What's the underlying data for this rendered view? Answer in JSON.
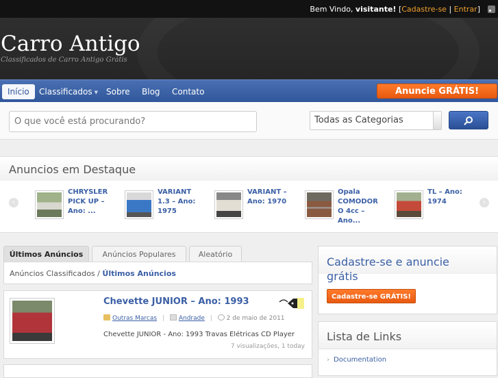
{
  "topbar": {
    "welcome_prefix": "Bem Vindo,",
    "welcome_user": "visitante!",
    "open_bracket": "[",
    "register": "Cadastre-se",
    "divider": "|",
    "login": "Entrar",
    "close_bracket": "]"
  },
  "header": {
    "logo": "Carro Antigo",
    "tagline": "Classificados de Carro Antigo Grátis"
  },
  "nav": {
    "items": [
      "Início",
      "Classificados",
      "Sobre",
      "Blog",
      "Contato"
    ],
    "cta": "Anuncie GRÁTIS!"
  },
  "search": {
    "placeholder": "O que você está procurando?",
    "category": "Todas as Categorias"
  },
  "featured": {
    "title": "Anuncios em Destaque",
    "items": [
      {
        "label": "CHRYSLER PICK UP – Ano: ...",
        "color": "#b9c3b0"
      },
      {
        "label": "VARIANT 1.3 – Ano: 1975",
        "color": "#3a78c5"
      },
      {
        "label": "VARIANT – Ano: 1970",
        "color": "#c9c4b8"
      },
      {
        "label": "Opala COMODOR O 4cc – Ano...",
        "color": "#8a5a40"
      },
      {
        "label": "TL – Ano: 1974",
        "color": "#c44a3a"
      }
    ]
  },
  "tabs": [
    "Últimos Anúncios",
    "Anúncios Populares",
    "Aleatório"
  ],
  "breadcrumb": {
    "root": "Anúncios Classificados",
    "separator": "/",
    "current": "Últimos Anúncios"
  },
  "listing": {
    "title": "Chevette JUNIOR – Ano: 1993",
    "category": "Outras Marcas",
    "author": "Andrade",
    "date": "2 de maio de 2011",
    "description": "Chevette JUNIOR - Ano: 1993 Travas Elétricas CD Player",
    "views": "7 visualizações, 1 today",
    "thumb_color": "#b0343a"
  },
  "sidebar": {
    "signup_title": "Cadastre-se e anuncie grátis",
    "signup_button": "Cadastre-se GRÁTIS!",
    "links_title": "Lista de Links",
    "links": [
      "Documentation"
    ]
  }
}
